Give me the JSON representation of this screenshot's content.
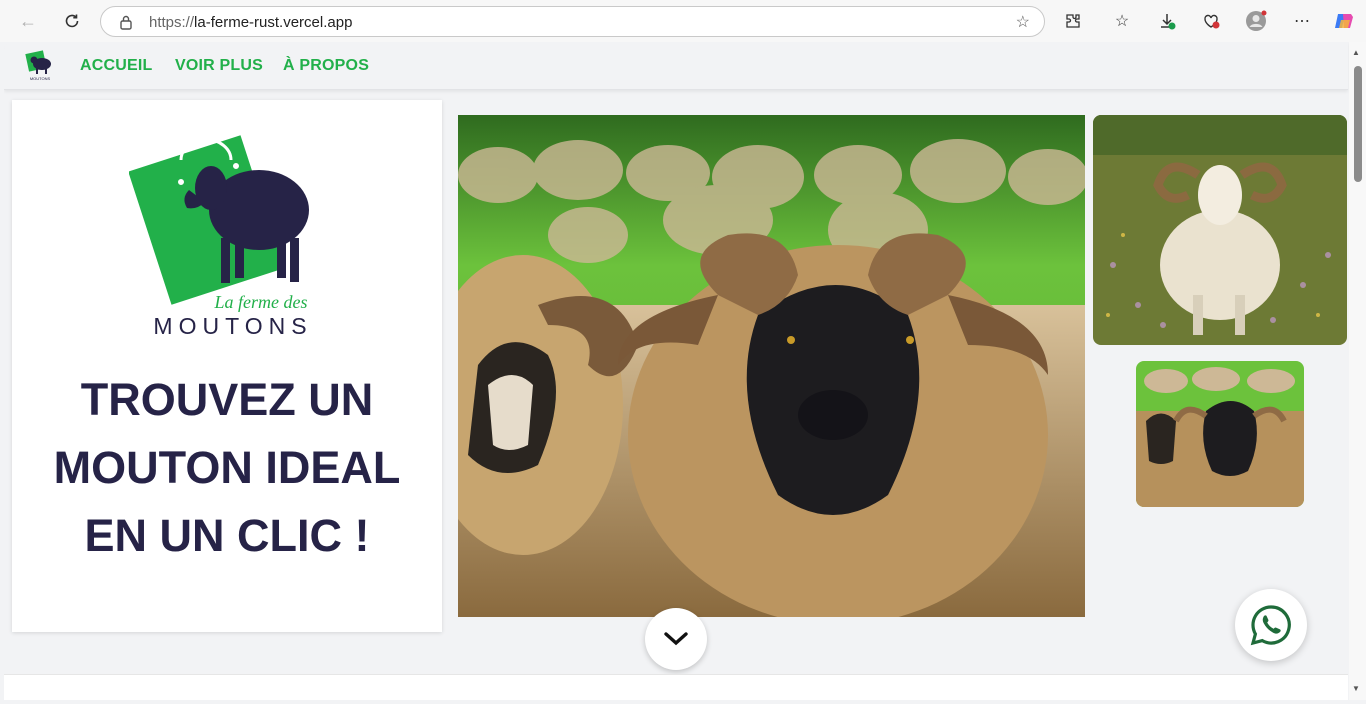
{
  "browser": {
    "url_scheme": "https://",
    "url_host": "la-ferme-rust.vercel.app"
  },
  "nav": {
    "links": [
      "ACCUEIL",
      "VOIR PLUS",
      "À PROPOS"
    ],
    "accent_color": "#22b04a"
  },
  "logo": {
    "script_text": "La ferme des",
    "word_text": "MOUTONS",
    "small_text": "MOUTONS",
    "green": "#22b04a",
    "navy": "#262347"
  },
  "hero": {
    "title_lines": [
      "TROUVEZ UN",
      "MOUTON IDEAL",
      "EN UN CLIC !"
    ]
  },
  "icons": {
    "scroll": "chevron-down-icon",
    "whatsapp": "whatsapp-icon"
  }
}
